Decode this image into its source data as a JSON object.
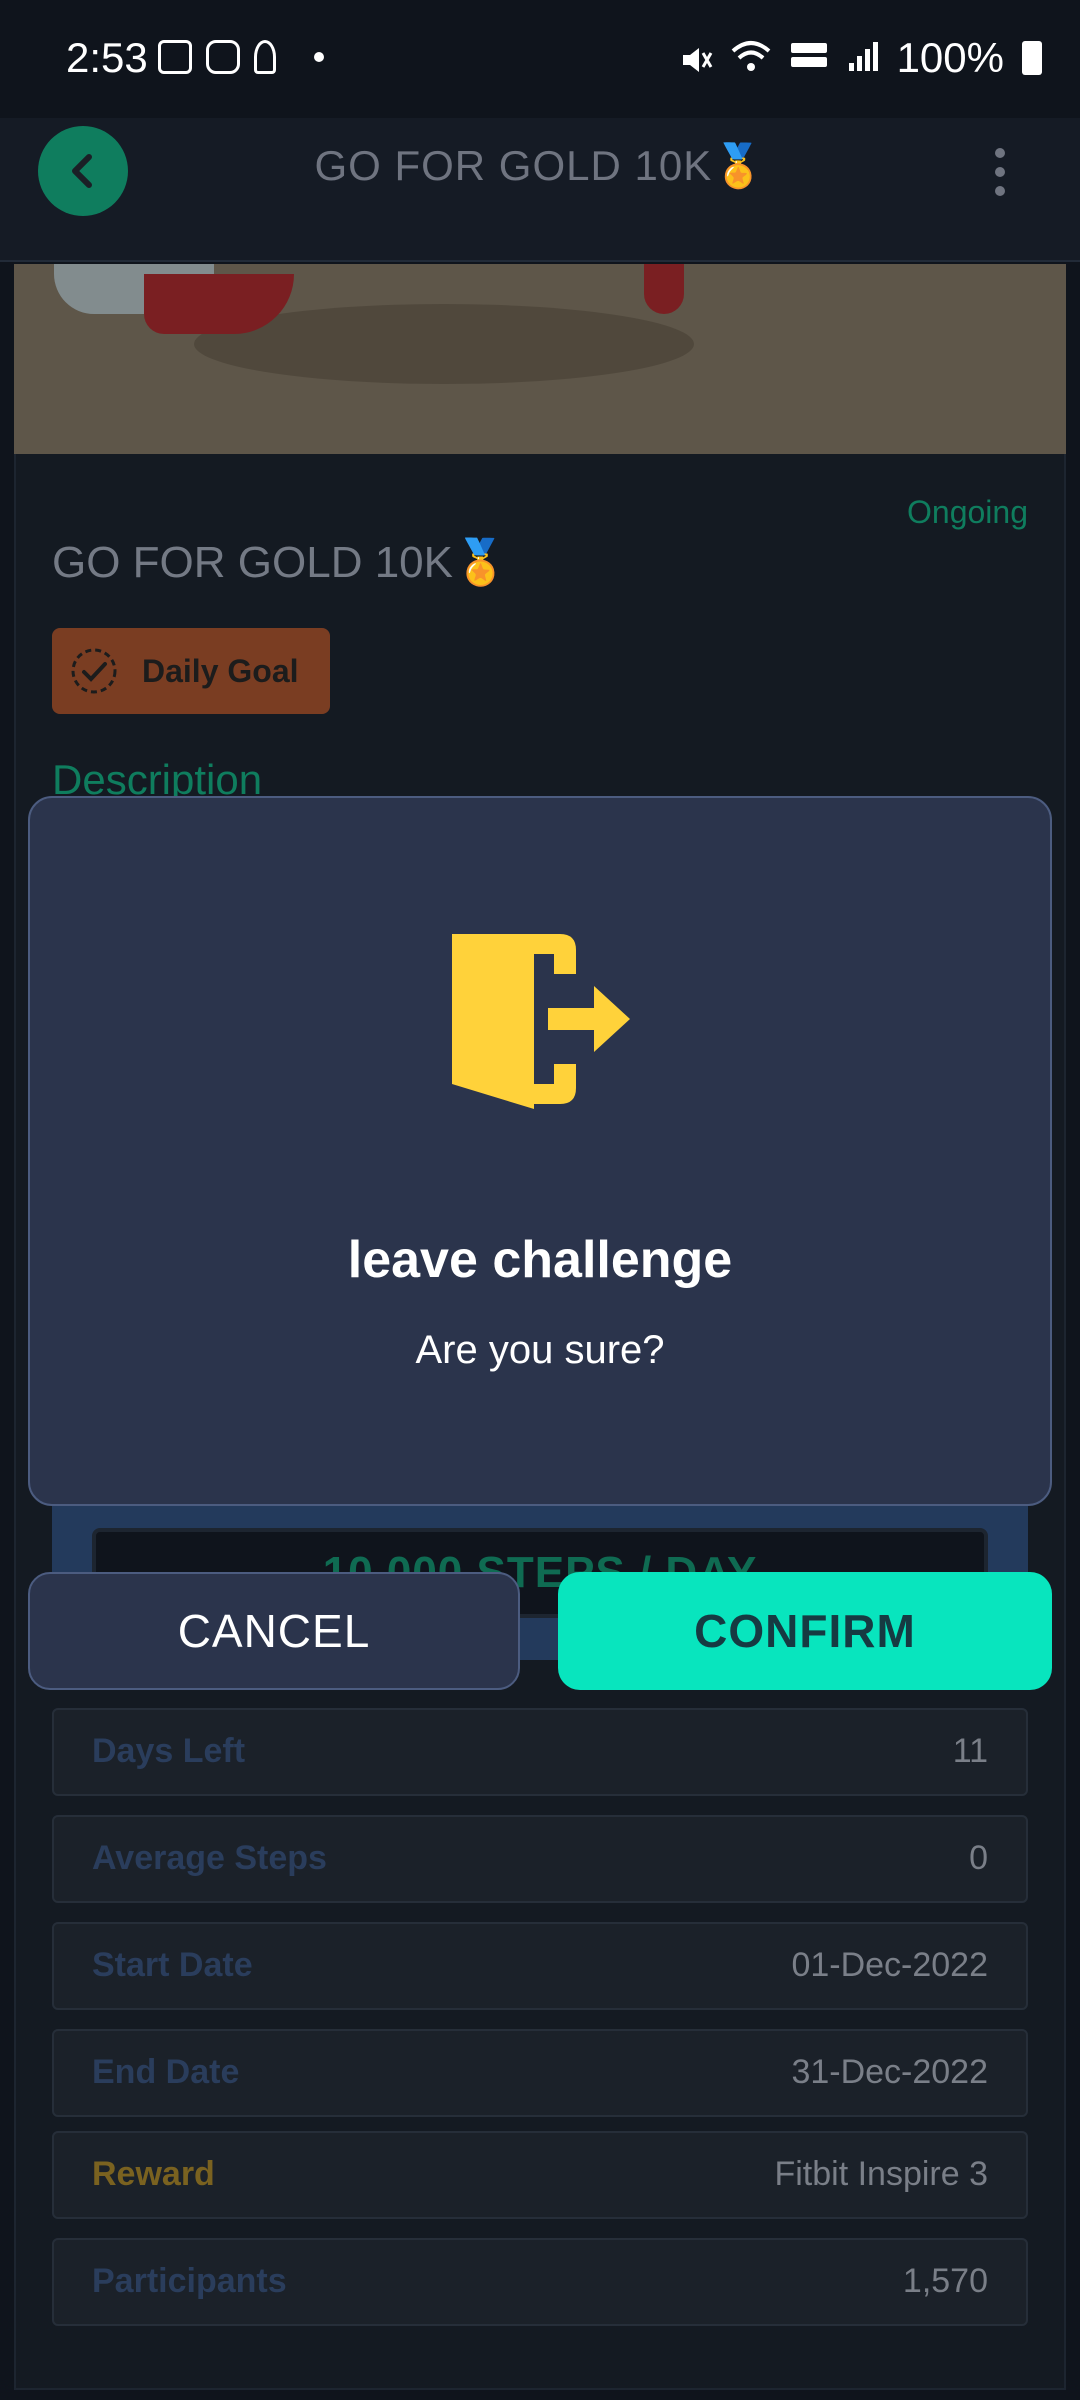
{
  "status_bar": {
    "time": "2:53",
    "battery": "100%"
  },
  "app_bar": {
    "title": "GO FOR GOLD 10K🏅"
  },
  "challenge": {
    "status": "Ongoing",
    "title": "GO FOR GOLD 10K🏅",
    "goal_type": "Daily Goal",
    "description_heading": "Description",
    "steps_target": "10,000 STEPS / DAY"
  },
  "details": [
    {
      "label": "Days Left",
      "value": "11"
    },
    {
      "label": "Average Steps",
      "value": "0"
    },
    {
      "label": "Start Date",
      "value": "01-Dec-2022"
    },
    {
      "label": "End Date",
      "value": "31-Dec-2022"
    },
    {
      "label": "Reward",
      "value": "Fitbit Inspire 3"
    },
    {
      "label": "Participants",
      "value": "1,570"
    }
  ],
  "dialog": {
    "icon": "exit-door-icon",
    "title": "leave challenge",
    "message": "Are you sure?",
    "cancel_label": "CANCEL",
    "confirm_label": "CONFIRM"
  },
  "colors": {
    "accent_teal": "#08e5be",
    "icon_yellow": "#ffd23a",
    "dialog_bg": "#2b344c",
    "back_button": "#0f7d5e"
  }
}
